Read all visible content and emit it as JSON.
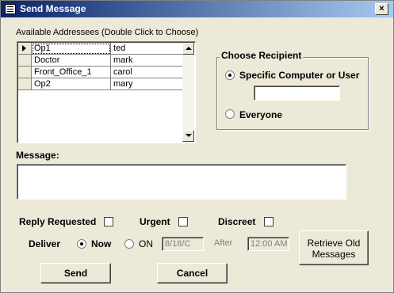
{
  "window": {
    "title": "Send Message",
    "close_label": "×"
  },
  "addressees": {
    "label": "Available Addressees (Double Click to Choose)",
    "rows": [
      {
        "computer": "Op1",
        "user": "ted"
      },
      {
        "computer": "Doctor",
        "user": "mark"
      },
      {
        "computer": "Front_Office_1",
        "user": "carol"
      },
      {
        "computer": "Op2",
        "user": "mary"
      }
    ]
  },
  "recipient": {
    "title": "Choose Recipient",
    "specific_label": "Specific Computer or User",
    "specific_value": "",
    "everyone_label": "Everyone",
    "selected": "specific"
  },
  "message": {
    "label": "Message:",
    "value": ""
  },
  "options": {
    "reply_label": "Reply Requested",
    "urgent_label": "Urgent",
    "discreet_label": "Discreet"
  },
  "deliver": {
    "label": "Deliver",
    "now_label": "Now",
    "on_label": "ON",
    "date_value": "8/18/C",
    "after_label": "After",
    "time_value": "12:00 AM",
    "selected": "now"
  },
  "buttons": {
    "send": "Send",
    "cancel": "Cancel",
    "retrieve_line1": "Retrieve Old",
    "retrieve_line2": "Messages"
  }
}
